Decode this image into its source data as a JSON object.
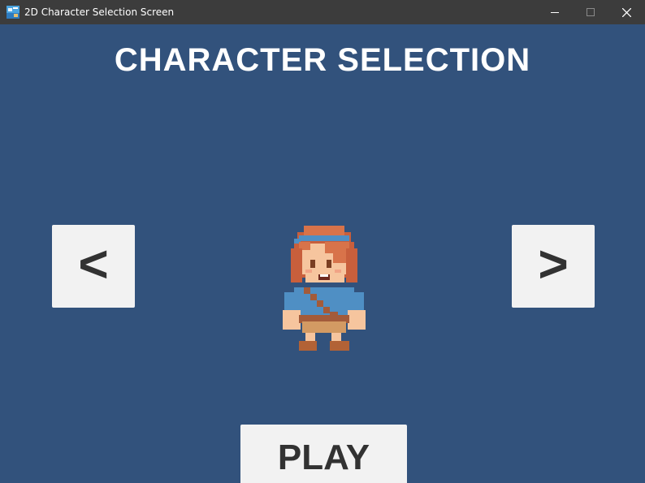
{
  "window": {
    "title": "2D Character Selection Screen",
    "icon": "unity-app-icon",
    "controls": [
      "minimize-icon",
      "maximize-icon",
      "close-icon"
    ]
  },
  "screen": {
    "heading": "CHARACTER SELECTION",
    "prev_label": "<",
    "next_label": ">",
    "play_label": "PLAY",
    "character_sprite": "pixel-adventurer-sprite"
  },
  "colors": {
    "background": "#32527c",
    "titlebar": "#3c3c3c",
    "button_bg": "#f2f2f2",
    "button_text": "#323232",
    "heading_text": "#ffffff"
  }
}
